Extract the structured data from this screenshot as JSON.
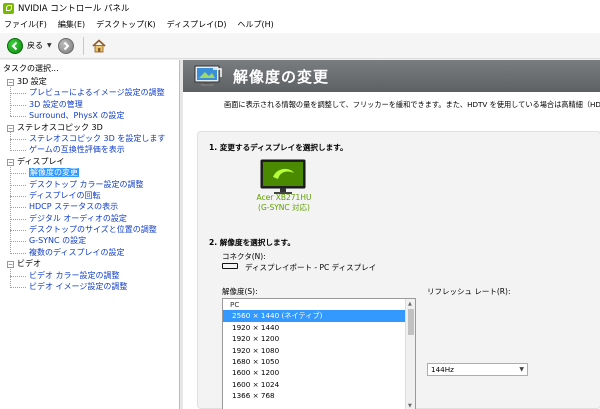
{
  "window": {
    "title": "NVIDIA コントロール パネル"
  },
  "menu": [
    "ファイル(F)",
    "編集(E)",
    "デスクトップ(K)",
    "ディスプレイ(D)",
    "ヘルプ(H)"
  ],
  "toolbar": {
    "back_label": "戻る"
  },
  "left_pane": {
    "header": "タスクの選択...",
    "tree": [
      {
        "label": "3D 設定",
        "type": "category",
        "expander": "−"
      },
      {
        "label": "プレビューによるイメージ設定の調整",
        "type": "item"
      },
      {
        "label": "3D 設定の管理",
        "type": "item"
      },
      {
        "label": "Surround、PhysX の設定",
        "type": "item"
      },
      {
        "label": "ステレオスコピック 3D",
        "type": "category",
        "expander": "−"
      },
      {
        "label": "ステレオスコピック 3D を設定します",
        "type": "item"
      },
      {
        "label": "ゲームの互換性評価を表示",
        "type": "item"
      },
      {
        "label": "ディスプレイ",
        "type": "category",
        "expander": "−"
      },
      {
        "label": "解像度の変更",
        "type": "item",
        "selected": true
      },
      {
        "label": "デスクトップ カラー設定の調整",
        "type": "item"
      },
      {
        "label": "ディスプレイの回転",
        "type": "item"
      },
      {
        "label": "HDCP ステータスの表示",
        "type": "item"
      },
      {
        "label": "デジタル オーディオの設定",
        "type": "item"
      },
      {
        "label": "デスクトップのサイズと位置の調整",
        "type": "item"
      },
      {
        "label": "G-SYNC の設定",
        "type": "item"
      },
      {
        "label": "複数のディスプレイの設定",
        "type": "item"
      },
      {
        "label": "ビデオ",
        "type": "category",
        "expander": "−"
      },
      {
        "label": "ビデオ カラー設定の調整",
        "type": "item"
      },
      {
        "label": "ビデオ イメージ設定の調整",
        "type": "item"
      }
    ]
  },
  "main": {
    "title": "解像度の変更",
    "description": "画面に表示される情報の量を調整して、フリッカーを緩和できます。また、HDTV を使用している場合は高精細（HD",
    "step1": "1. 変更するディスプレイを選択します。",
    "display": {
      "name_line1": "Acer XB271HU",
      "name_line2": "(G-SYNC 対応)"
    },
    "step2": "2. 解像度を選択します。",
    "connector_label": "コネクタ(N):",
    "connector_value": "ディスプレイポート - PC ディスプレイ",
    "resolution_label": "解像度(S):",
    "refresh_label": "リフレッシュ レート(R):",
    "refresh_value": "144Hz",
    "resolution_list": {
      "group": "PC",
      "items": [
        {
          "label": "2560 × 1440 (ネイティブ)",
          "selected": true
        },
        {
          "label": "1920 × 1440"
        },
        {
          "label": "1920 × 1200"
        },
        {
          "label": "1920 × 1080"
        },
        {
          "label": "1680 × 1050"
        },
        {
          "label": "1600 × 1200"
        },
        {
          "label": "1600 × 1024"
        },
        {
          "label": "1366 × 768"
        }
      ]
    }
  },
  "colors": {
    "nvidia_green": "#76b900",
    "link_blue": "#0f3cc9",
    "selection": "#3399ff",
    "banner": "#6b6e71"
  }
}
